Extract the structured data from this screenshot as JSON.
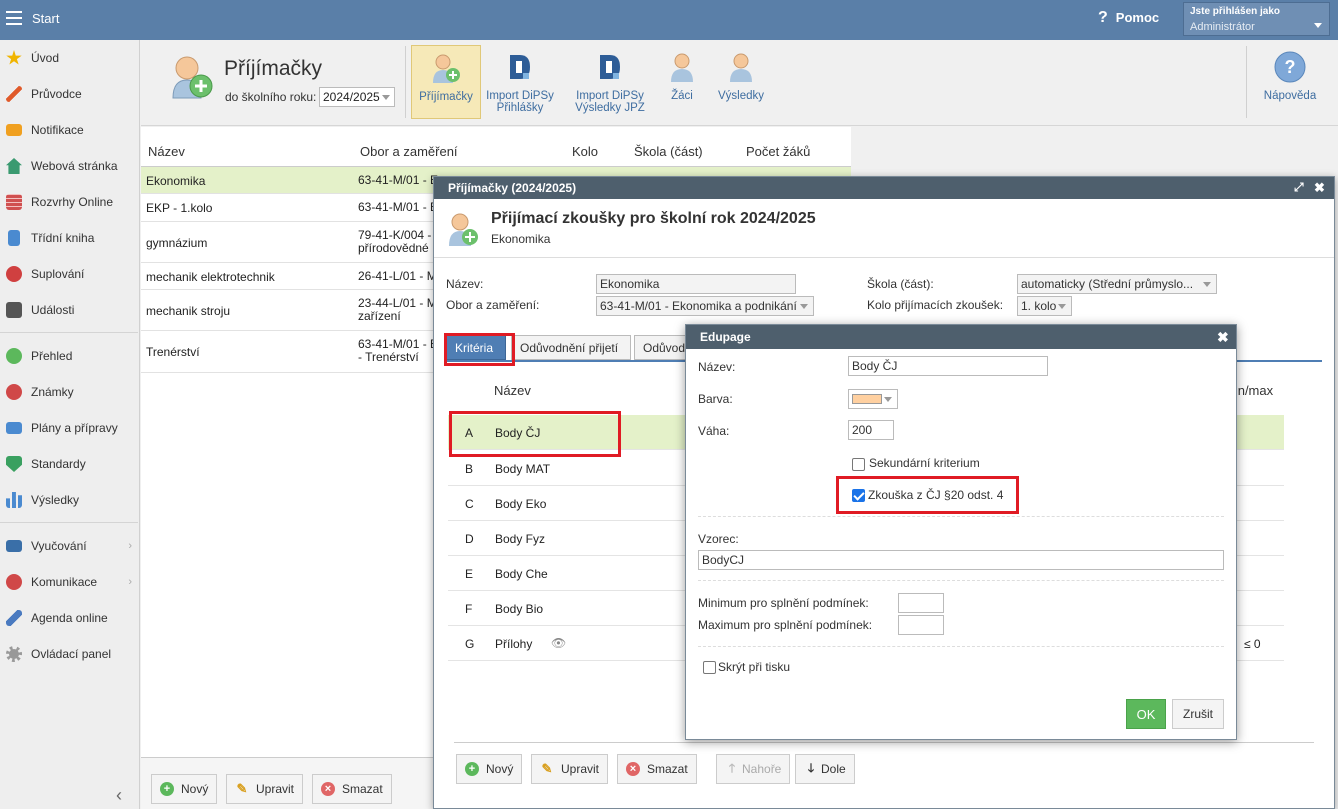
{
  "topbar": {
    "start_label": "Start",
    "help_label": "Pomoc",
    "user_line1": "Jste přihlášen jako",
    "user_line2": "Administrátor"
  },
  "sidebar": {
    "items": [
      {
        "label": "Úvod",
        "icon": "star-icon",
        "color": "#f0b400"
      },
      {
        "label": "Průvodce",
        "icon": "magic-wand-icon",
        "color": "#e05a2a"
      },
      {
        "label": "Notifikace",
        "icon": "envelope-icon",
        "color": "#f0a020"
      },
      {
        "label": "Webová stránka",
        "icon": "home-icon",
        "color": "#3a9a70"
      },
      {
        "label": "Rozvrhy Online",
        "icon": "calendar-grid-icon",
        "color": "#d05050"
      },
      {
        "label": "Třídní kniha",
        "icon": "book-icon",
        "color": "#4a8ad0"
      },
      {
        "label": "Suplování",
        "icon": "person-icon",
        "color": "#d04040"
      },
      {
        "label": "Události",
        "icon": "calendar-icon",
        "color": "#555555"
      },
      {
        "label": "Přehled",
        "icon": "check-circle-icon",
        "color": "#5cb85c"
      },
      {
        "label": "Známky",
        "icon": "grade-icon",
        "color": "#d04848"
      },
      {
        "label": "Plány a přípravy",
        "icon": "briefcase-icon",
        "color": "#4a8ad0"
      },
      {
        "label": "Standardy",
        "icon": "shield-icon",
        "color": "#3aa060"
      },
      {
        "label": "Výsledky",
        "icon": "bar-chart-icon",
        "color": "#4a8ad0"
      },
      {
        "label": "Vyučování",
        "icon": "open-book-icon",
        "color": "#3a6fa8"
      },
      {
        "label": "Komunikace",
        "icon": "chat-icon",
        "color": "#d04848"
      },
      {
        "label": "Agenda online",
        "icon": "pen-icon",
        "color": "#4a7ac0"
      },
      {
        "label": "Ovládací panel",
        "icon": "gear-icon",
        "color": "#999999"
      }
    ]
  },
  "header": {
    "title": "Příjímačky",
    "year_label": "do školního roku:",
    "year_value": "2024/2025",
    "toolbar": [
      {
        "label": "Příjímačky",
        "icon": "person-add-icon"
      },
      {
        "label": "Import DiPSy Přihlášky",
        "icon": "dipsy-icon"
      },
      {
        "label": "Import DiPSy Výsledky JPZ",
        "icon": "dipsy-icon"
      },
      {
        "label": "Žáci",
        "icon": "person-icon"
      },
      {
        "label": "Výsledky",
        "icon": "person-icon"
      }
    ],
    "help_label": "Nápověda"
  },
  "list": {
    "columns": [
      "Název",
      "Obor a zaměření",
      "Kolo",
      "Škola (část)",
      "Počet žáků"
    ],
    "rows": [
      {
        "name": "Ekonomika",
        "obor": "63-41-M/01 - E",
        "obor2": ""
      },
      {
        "name": "EKP - 1.kolo",
        "obor": "63-41-M/01 - E",
        "obor2": ""
      },
      {
        "name": "gymnázium",
        "obor": "79-41-K/004 -",
        "obor2": "přírodovědné"
      },
      {
        "name": "mechanik elektrotechnik",
        "obor": "26-41-L/01 - M",
        "obor2": ""
      },
      {
        "name": "mechanik stroju",
        "obor": "23-44-L/01 - M",
        "obor2": "zařízení"
      },
      {
        "name": "Trenérství",
        "obor": "63-41-M/01 - E",
        "obor2": "- Trenérství"
      }
    ],
    "buttons": {
      "new": "Nový",
      "edit": "Upravit",
      "delete": "Smazat"
    }
  },
  "dialog": {
    "titlebar": "Příjímačky (2024/2025)",
    "heading": "Přijímací zkoušky pro školní rok 2024/2025",
    "subheading": "Ekonomika",
    "fields": {
      "nazev_label": "Název:",
      "nazev_value": "Ekonomika",
      "obor_label": "Obor a zaměření:",
      "obor_value": "63-41-M/01 - Ekonomika a podnikání",
      "skola_label": "Škola (část):",
      "skola_value": "automaticky (Střední průmyslo...",
      "kolo_label": "Kolo přijímacích zkoušek:",
      "kolo_value": "1. kolo"
    },
    "tabs": [
      "Kritéria",
      "Odůvodnění přijetí",
      "Odůvod"
    ],
    "table": {
      "col_name": "Název",
      "col_minmax": "min/max",
      "rows": [
        {
          "letter": "A",
          "name": "Body ČJ"
        },
        {
          "letter": "B",
          "name": "Body MAT"
        },
        {
          "letter": "C",
          "name": "Body Eko"
        },
        {
          "letter": "D",
          "name": "Body Fyz"
        },
        {
          "letter": "E",
          "name": "Body Che"
        },
        {
          "letter": "F",
          "name": "Body Bio"
        },
        {
          "letter": "G",
          "name": "Přílohy"
        }
      ],
      "g_minmax": "≤ 0"
    },
    "buttons": {
      "new": "Nový",
      "edit": "Upravit",
      "delete": "Smazat",
      "up": "Nahoře",
      "down": "Dole"
    }
  },
  "edupage": {
    "titlebar": "Edupage",
    "nazev_label": "Název:",
    "nazev_value": "Body ČJ",
    "barva_label": "Barva:",
    "barva_color": "#ffd0a0",
    "vaha_label": "Váha:",
    "vaha_value": "200",
    "secondary_label": "Sekundární kriterium",
    "zkouska_label": "Zkouška z ČJ §20 odst. 4",
    "vzorec_label": "Vzorec:",
    "vzorec_value": "BodyCJ",
    "min_label": "Minimum pro splnění podmínek:",
    "max_label": "Maximum pro splnění podmínek:",
    "hide_label": "Skrýt při tisku",
    "ok": "OK",
    "cancel": "Zrušit"
  }
}
